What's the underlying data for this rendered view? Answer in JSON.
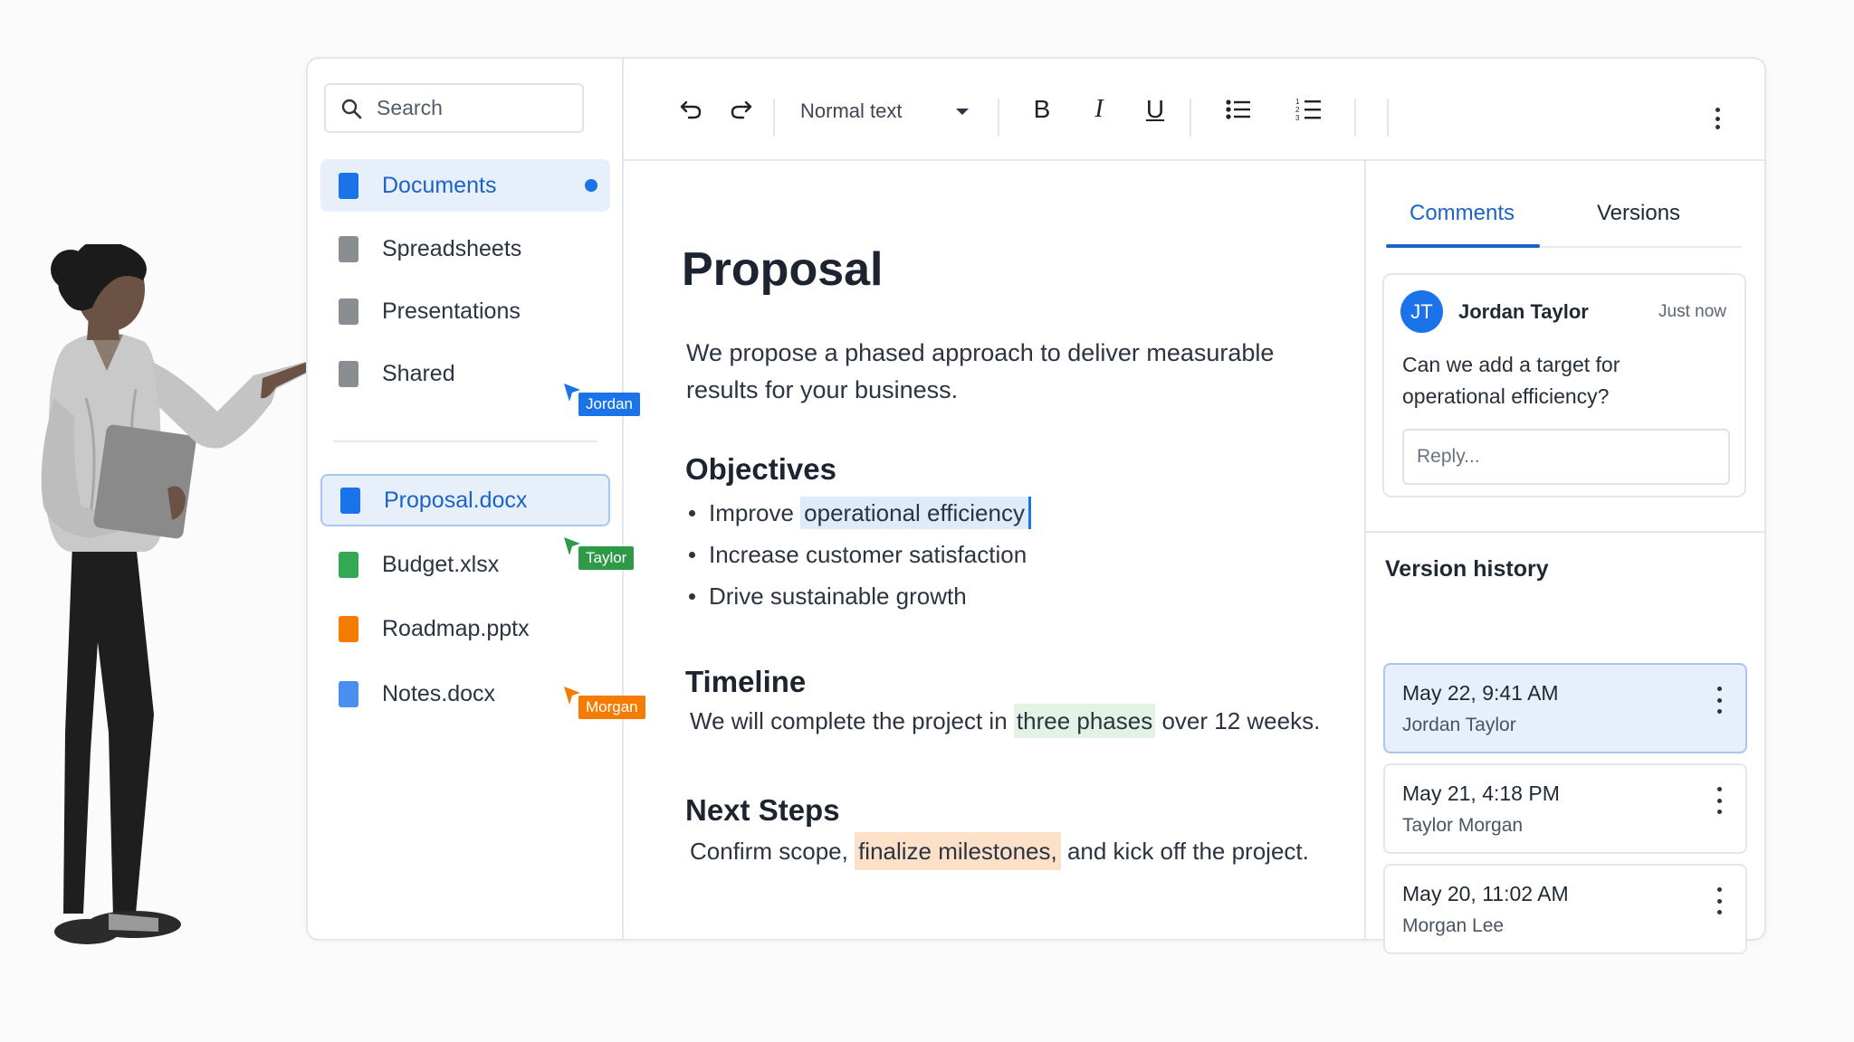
{
  "sidebar": {
    "search_placeholder": "Search",
    "nav": [
      {
        "label": "Documents",
        "color": "#1a73e8"
      },
      {
        "label": "Spreadsheets",
        "color": "#8a8d91"
      },
      {
        "label": "Presentations",
        "color": "#8a8d91"
      },
      {
        "label": "Shared",
        "color": "#8a8d91"
      }
    ],
    "files": [
      {
        "label": "Proposal.docx",
        "color": "#1a73e8"
      },
      {
        "label": "Budget.xlsx",
        "color": "#34a853"
      },
      {
        "label": "Roadmap.pptx",
        "color": "#f57c00"
      },
      {
        "label": "Notes.docx",
        "color": "#4a8ef0"
      }
    ],
    "cursors": [
      {
        "name": "Jordan",
        "color": "#1a73e8"
      },
      {
        "name": "Taylor",
        "color": "#2e9a48"
      },
      {
        "name": "Morgan",
        "color": "#f57c00"
      }
    ]
  },
  "toolbar": {
    "style_value": "Normal text",
    "bold_label": "B",
    "italic_label": "I",
    "underline_label": "U"
  },
  "document": {
    "title": "Proposal",
    "intro": "We propose a phased approach to deliver measurable results for your business.",
    "objectives_heading": "Objectives",
    "objectives": {
      "item1_prefix": "Improve ",
      "item1_highlight": "operational efficiency",
      "item2": "Increase customer satisfaction",
      "item3": "Drive sustainable growth"
    },
    "timeline_heading": "Timeline",
    "timeline": {
      "prefix": "We will complete the project in ",
      "highlight": "three phases",
      "suffix": " over 12 weeks."
    },
    "next_steps_heading": "Next Steps",
    "next_steps": {
      "prefix": "Confirm scope, ",
      "highlight": "finalize milestones,",
      "suffix": " and kick off the project."
    }
  },
  "panel": {
    "tabs": [
      {
        "label": "Comments",
        "active": true
      },
      {
        "label": "Versions",
        "active": false
      }
    ],
    "comment": {
      "initials": "JT",
      "author": "Jordan Taylor",
      "time": "Just now",
      "text": "Can we add a target for operational efficiency?",
      "reply_placeholder": "Reply..."
    },
    "version_history_title": "Version history",
    "versions": [
      {
        "date": "May 22, 9:41 AM",
        "author": "Jordan Taylor",
        "active": true
      },
      {
        "date": "May 21, 4:18 PM",
        "author": "Taylor Morgan",
        "active": false
      },
      {
        "date": "May 20, 11:02 AM",
        "author": "Morgan Lee",
        "active": false
      }
    ]
  },
  "icons": [
    "search-icon",
    "undo-icon",
    "redo-icon",
    "bulleted-list-icon",
    "numbered-list-icon",
    "more-vertical-icon",
    "cursor-icon"
  ]
}
